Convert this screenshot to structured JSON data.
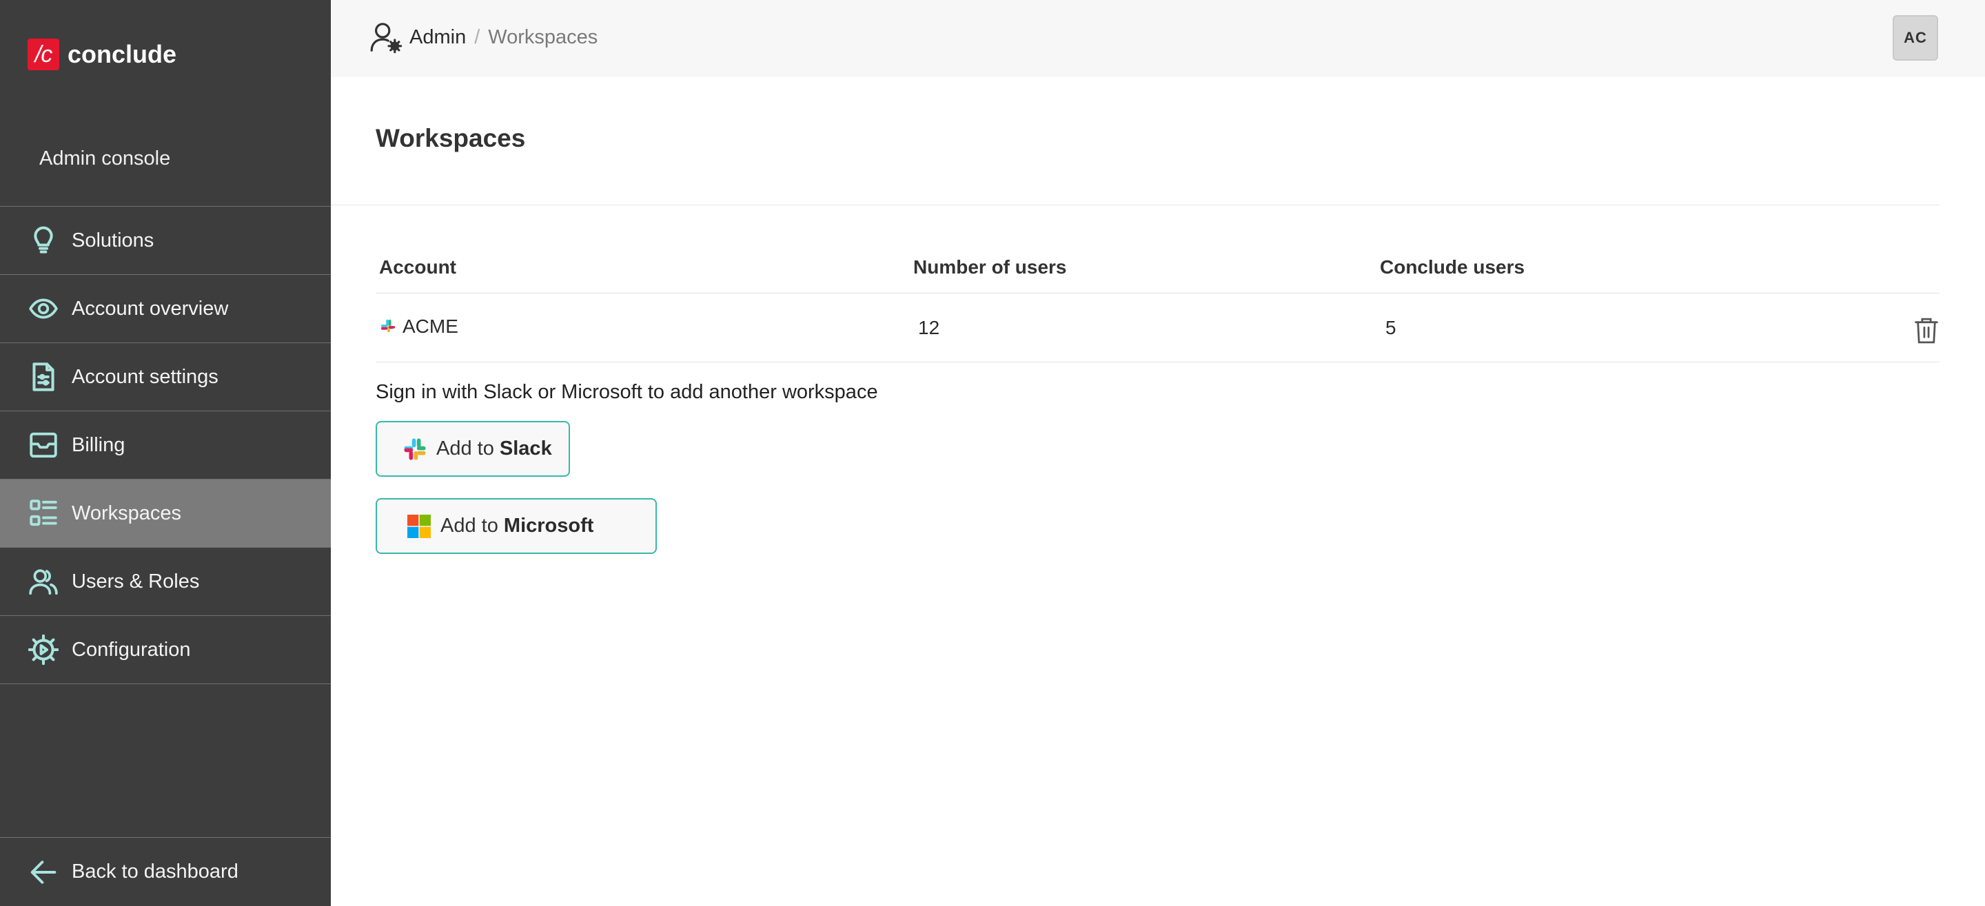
{
  "app": {
    "logo_mark": "/c",
    "logo_text": "conclude",
    "section_title": "Admin console"
  },
  "sidebar": {
    "items": [
      {
        "label": "Solutions",
        "icon": "lightbulb-icon"
      },
      {
        "label": "Account overview",
        "icon": "eye-icon"
      },
      {
        "label": "Account settings",
        "icon": "document-settings-icon"
      },
      {
        "label": "Billing",
        "icon": "envelope-icon"
      },
      {
        "label": "Workspaces",
        "icon": "list-icon",
        "active": true
      },
      {
        "label": "Users & Roles",
        "icon": "users-icon"
      },
      {
        "label": "Configuration",
        "icon": "gear-icon"
      }
    ],
    "back_label": "Back to dashboard"
  },
  "header": {
    "breadcrumb": {
      "root": "Admin",
      "separator": "/",
      "current": "Workspaces"
    },
    "avatar_initials": "AC"
  },
  "main": {
    "title": "Workspaces",
    "table": {
      "columns": [
        "Account",
        "Number of users",
        "Conclude users"
      ],
      "rows": [
        {
          "account": "ACME",
          "number_of_users": "12",
          "conclude_users": "5",
          "platform_icon": "slack-icon"
        }
      ]
    },
    "signin_text": "Sign in with Slack or Microsoft to add another workspace",
    "slack_button": {
      "prefix": "Add to ",
      "brand": "Slack"
    },
    "microsoft_button": {
      "prefix": "Add to ",
      "brand": "Microsoft"
    }
  },
  "colors": {
    "sidebar_bg": "#3d3d3d",
    "sidebar_active": "#7b7b7b",
    "accent": "#38b8ad",
    "icon_tint": "#a9e3dd",
    "brand_red": "#e5172f"
  }
}
